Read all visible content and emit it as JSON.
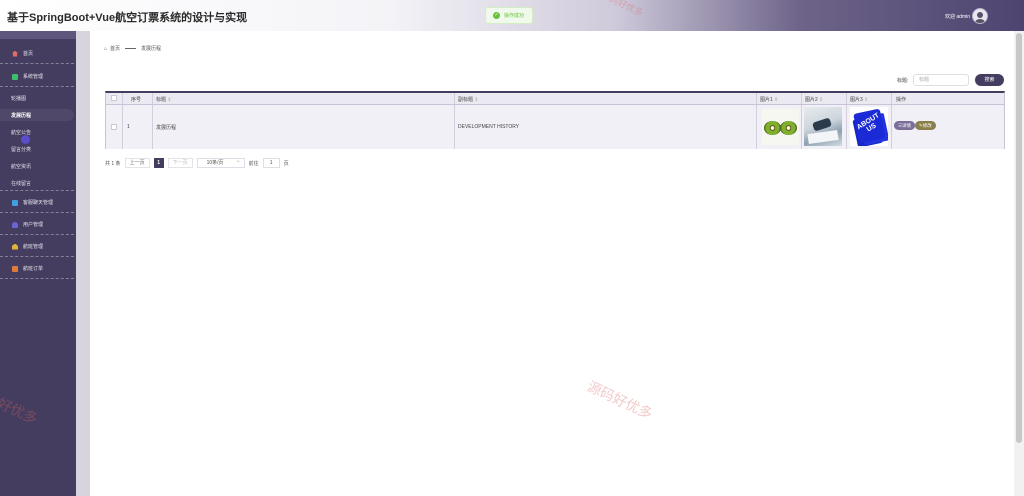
{
  "header": {
    "title": "基于SpringBoot+Vue航空订票系统的设计与实现",
    "toast": "操作成功",
    "welcome": "欢迎 admin"
  },
  "sidebar": {
    "items": [
      {
        "label": "首页",
        "icon": "home-icon",
        "color": "#e06a6a"
      },
      {
        "label": "系统管理",
        "icon": "system-icon",
        "color": "#3bbf6a"
      },
      {
        "label": "客服聊天管理",
        "icon": "chat-icon",
        "color": "#3ea0e0"
      },
      {
        "label": "用户管理",
        "icon": "user-icon",
        "color": "#6a64d6"
      },
      {
        "label": "航班管理",
        "icon": "flight-icon",
        "color": "#e0b43a"
      },
      {
        "label": "航班订单",
        "icon": "order-icon",
        "color": "#e07a3a"
      }
    ],
    "sub_items": [
      {
        "label": "轮播图"
      },
      {
        "label": "发展历程"
      },
      {
        "label": "航空公告"
      },
      {
        "label": "留言分类"
      },
      {
        "label": "航空资讯"
      },
      {
        "label": "在线留言"
      }
    ]
  },
  "breadcrumb": {
    "home": "首页",
    "current": "发展历程"
  },
  "search": {
    "label": "标题:",
    "placeholder": "标题",
    "button": "搜索"
  },
  "table": {
    "headers": {
      "index": "序号",
      "title": "标题",
      "subtitle": "副标题",
      "image1": "图片1",
      "image2": "图片2",
      "image3": "图片3",
      "actions": "操作"
    },
    "sort_icon": "⇕",
    "rows": [
      {
        "index": "1",
        "title": "发展历程",
        "subtitle": "DEVELOPMENT HISTORY",
        "image3_text": "ABOUT US"
      }
    ],
    "buttons": {
      "detail": "详情",
      "edit": "修改"
    }
  },
  "pagination": {
    "total": "共 1 条",
    "prev": "上一页",
    "current": "1",
    "next": "下一页",
    "page_size": "10条/页",
    "goto_label": "前往",
    "goto_value": "1",
    "page_suffix": "页"
  },
  "watermark": "源码好优多",
  "colors": {
    "primary": "#443d5f",
    "success": "#67c23a"
  }
}
